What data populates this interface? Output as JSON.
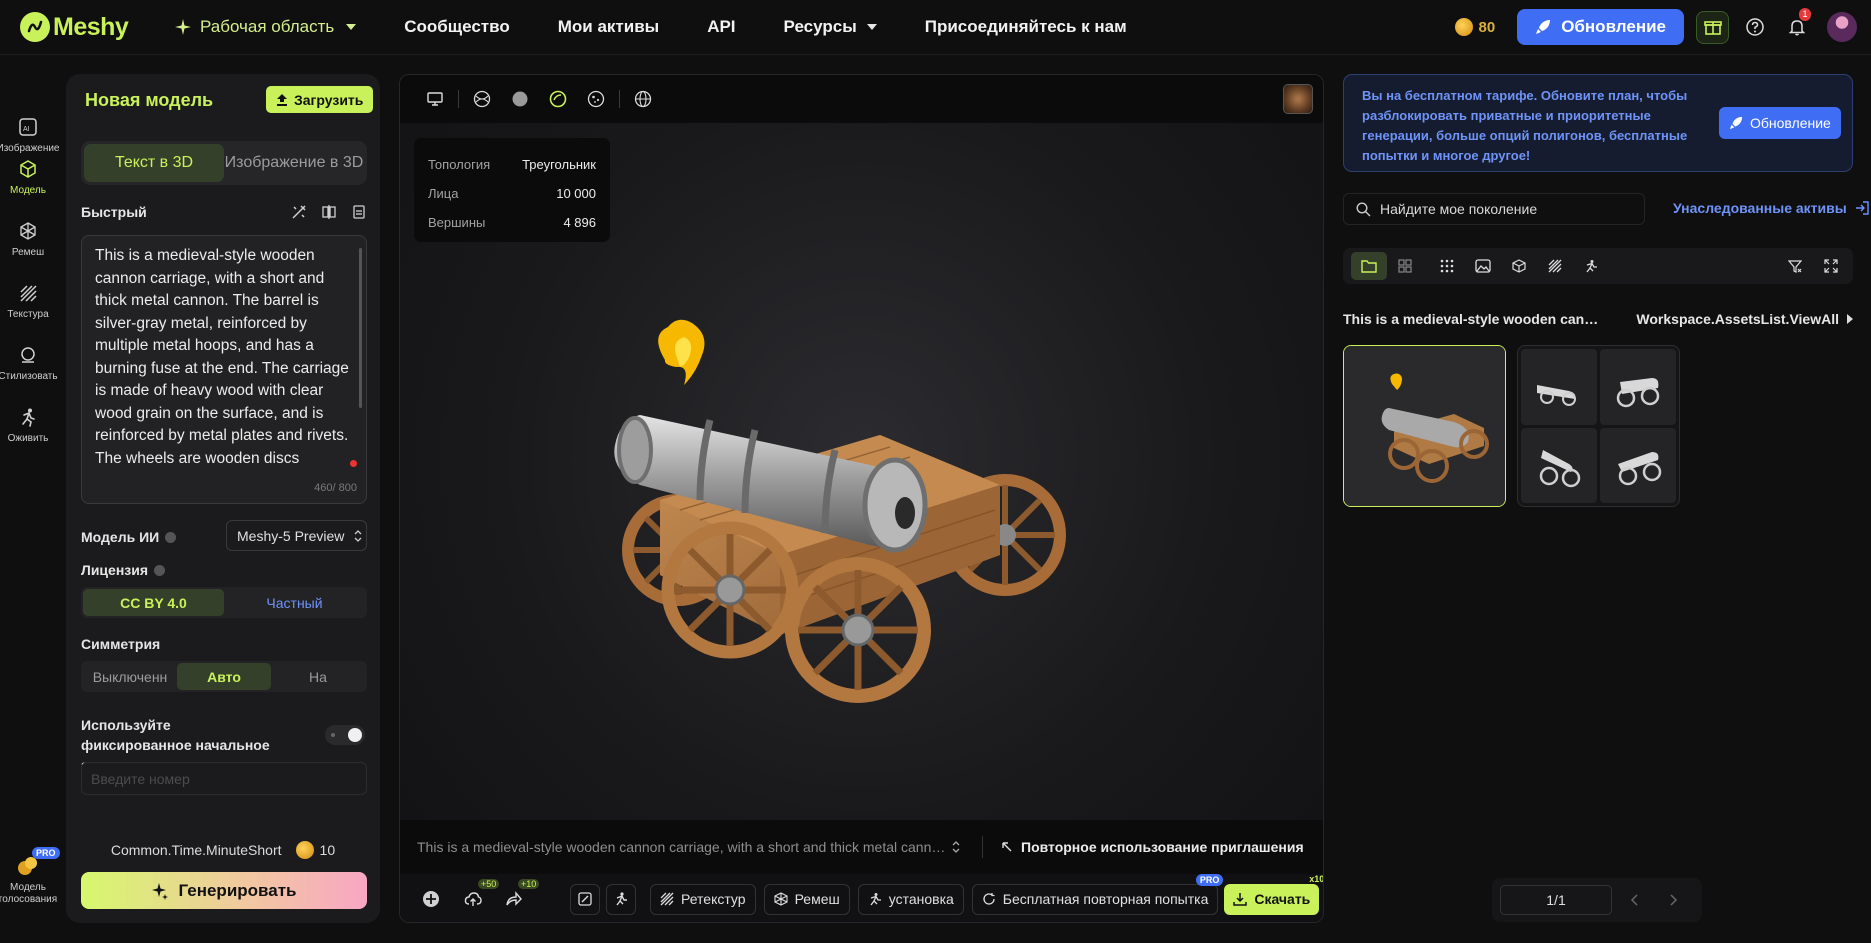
{
  "header": {
    "logo_text": "Meshy",
    "workspace_label": "Рабочая область",
    "nav": [
      "Сообщество",
      "Мои активы",
      "API",
      "Ресурсы",
      "Присоединяйтесь к нам"
    ],
    "credits": "80",
    "upgrade_label": "Обновление",
    "notification_count": "1"
  },
  "rail": {
    "items": [
      {
        "label": "Изображение",
        "icon": "ai-image-icon"
      },
      {
        "label": "Модель",
        "icon": "cube-icon",
        "active": true
      },
      {
        "label": "Ремеш",
        "icon": "remesh-icon"
      },
      {
        "label": "Текстура",
        "icon": "texture-icon"
      },
      {
        "label": "Стилизовать",
        "icon": "stylize-icon"
      },
      {
        "label": "Оживить",
        "icon": "animate-icon"
      }
    ],
    "bottom": {
      "label_line1": "Модель",
      "label_line2": "голосования",
      "badge": "PRO"
    }
  },
  "panel": {
    "title": "Новая модель",
    "upload_label": "Загрузить",
    "tabs": [
      "Текст в 3D",
      "Изображение в 3D"
    ],
    "mode_label": "Быстрый",
    "prompt": "This is a medieval-style wooden cannon carriage, with a short and thick metal cannon. The barrel is silver-gray metal, reinforced by multiple metal hoops, and has a burning fuse at the end. The carriage is made of heavy wood with clear wood grain on the surface, and is reinforced by metal plates and rivets. The wheels are wooden discs",
    "char_count": "460/ 800",
    "ai_model_label": "Модель ИИ",
    "ai_model_value": "Meshy-5 Preview",
    "license_label": "Лицензия",
    "license_options": [
      "CC BY 4.0",
      "Частный"
    ],
    "symmetry_label": "Симметрия",
    "symmetry_options": [
      "Выключенн",
      "Авто",
      "На"
    ],
    "seed_label": "Используйте фиксированное начальное значение",
    "seed_placeholder": "Введите номер",
    "time_label": "Common.Time.MinuteShort",
    "cost": "10",
    "generate_label": "Генерировать"
  },
  "viewport": {
    "stats": {
      "topology_label": "Топология",
      "topology_value": "Треугольник",
      "faces_label": "Лица",
      "faces_value": "10 000",
      "vertices_label": "Вершины",
      "vertices_value": "4 896"
    },
    "prompt_preview": "This is a medieval-style wooden cannon carriage, with a short and thick metal cannon. The barrel is silver-gray metal",
    "reuse_label": "Повторное использование приглашения",
    "bonus_upload": "+50",
    "bonus_share": "+10",
    "actions": [
      "Ретекстур",
      "Ремеш",
      "установка",
      "Бесплатная повторная попытка"
    ],
    "retry_badge": "PRO",
    "download_label": "Скачать",
    "download_badge": "x10"
  },
  "right": {
    "notice": "Вы на бесплатном тарифе. Обновите план, чтобы разблокировать приватные и приоритетные генерации, больше опций полигонов, бесплатные попытки и многое другое!",
    "notice_button": "Обновление",
    "search_placeholder": "Найдите мое поколение",
    "inherited_label": "Унаследованные активы",
    "asset_title": "This is a medieval-style wooden cannon ca...",
    "view_all": "Workspace.AssetsList.ViewAll",
    "page": "1/1"
  },
  "colors": {
    "accent": "#c9f25a",
    "blue": "#3f6df4",
    "bg": "#0f0f10",
    "panel": "#1b1b1d"
  }
}
